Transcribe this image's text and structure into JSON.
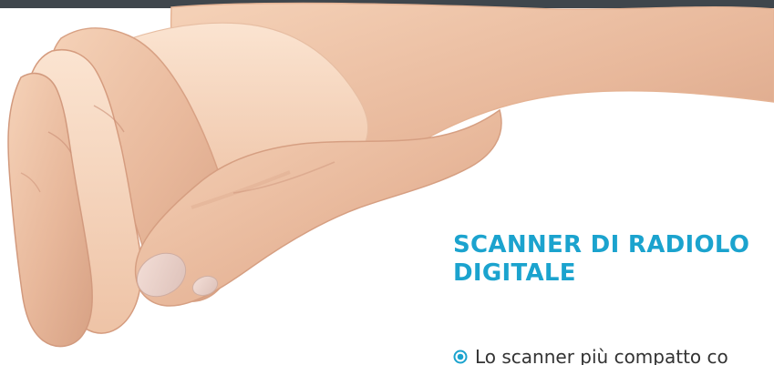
{
  "colors": {
    "top_bar": "#3f464c",
    "accent": "#1ba3ce",
    "bullet_ring": "#1ba3ce",
    "bullet_center": "#1ba3ce",
    "text": "#333333"
  },
  "top_bar": {
    "icon": "dark-header-bar"
  },
  "hero": {
    "image_icon": "hand-image"
  },
  "product": {
    "title_line_1": "SCANNER DI RADIOLO",
    "title_line_2": "DIGITALE"
  },
  "features": [
    {
      "icon": "bullet-icon",
      "text": "Lo scanner più compatto co"
    }
  ]
}
